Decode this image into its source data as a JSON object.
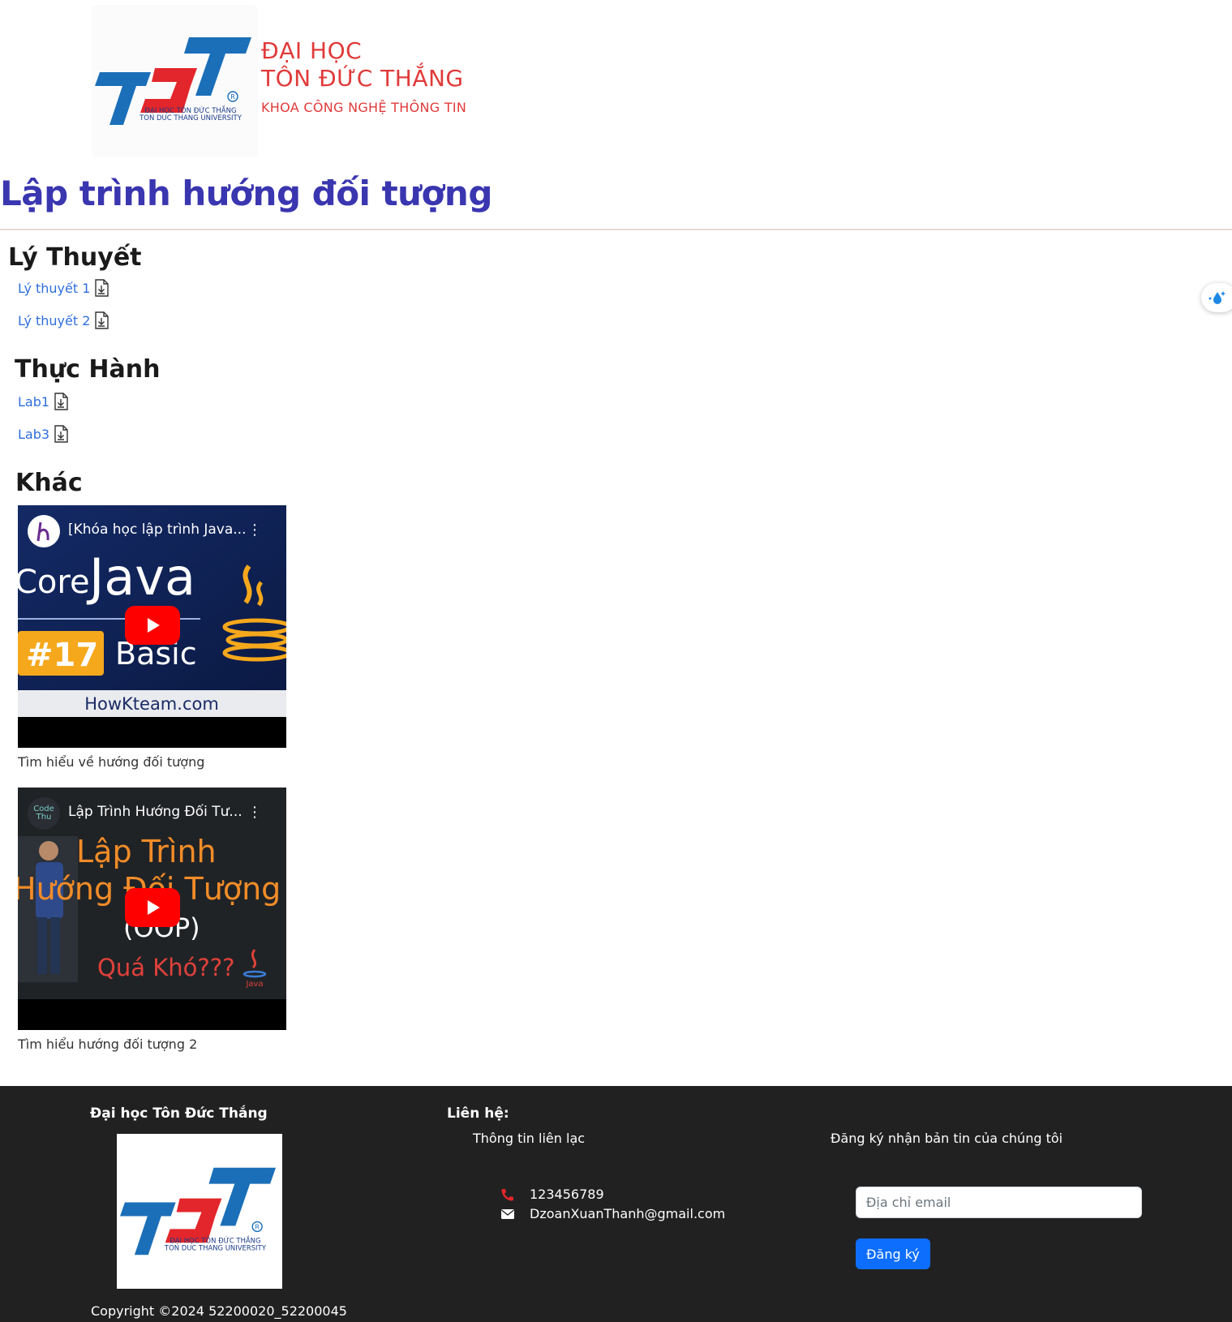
{
  "header": {
    "logo_text": "TDT",
    "logo_caption_1": "ĐẠI HỌC TÔN ĐỨC THẮNG",
    "logo_caption_2": "TON DUC THANG UNIVERSITY",
    "university_line1": "ĐẠI HỌC",
    "university_line2": "TÔN ĐỨC THẮNG",
    "faculty": "KHOA CÔNG NGHỆ THÔNG TIN"
  },
  "page": {
    "title": "Lập trình hướng đối tượng"
  },
  "sections": {
    "theory": {
      "title": "Lý Thuyết",
      "links": [
        {
          "label": "Lý thuyết 1"
        },
        {
          "label": "Lý thuyết 2"
        }
      ]
    },
    "practice": {
      "title": "Thực Hành",
      "links": [
        {
          "label": "Lab1"
        },
        {
          "label": "Lab3"
        }
      ]
    },
    "other": {
      "title": "Khác",
      "videos": [
        {
          "title": "[Khóa học lập trình Java...",
          "thumb_lines": [
            "Core",
            "Java",
            "#17",
            "Basic",
            "HowKteam.com"
          ],
          "caption": "Tìm hiểu về hướng đối tượng"
        },
        {
          "title": "Lập Trình Hướng Đối Tư...",
          "channel": "Code Thu",
          "thumb_lines": [
            "Lập Trình",
            "Hướng Đối Tượng",
            "(OOP)",
            "Quá Khó???",
            "Java"
          ],
          "caption": "Tìm hiểu hướng đối tượng 2"
        }
      ]
    }
  },
  "footer": {
    "brand_title": "Đại học Tôn Đức Thắng",
    "contact_title": "Liên hệ:",
    "contact_subtitle": "Thông tin liên lạc",
    "phone": "123456789",
    "email": "DzoanXuanThanh@gmail.com",
    "newsletter_title": "Đăng ký nhận bản tin của chúng tôi",
    "email_placeholder": "Địa chỉ email",
    "subscribe_label": "Đăng ký",
    "copyright": "Copyright ©2024 52200020_52200045"
  },
  "colors": {
    "title": "#3a36b0",
    "brand_red": "#e03a3a",
    "link": "#2f6fdc",
    "footer_bg": "#212121",
    "button": "#0d6efd"
  },
  "icons": {
    "download": "file-download-icon",
    "phone": "phone-icon",
    "mail": "envelope-icon",
    "widget": "water-drop-icon"
  }
}
